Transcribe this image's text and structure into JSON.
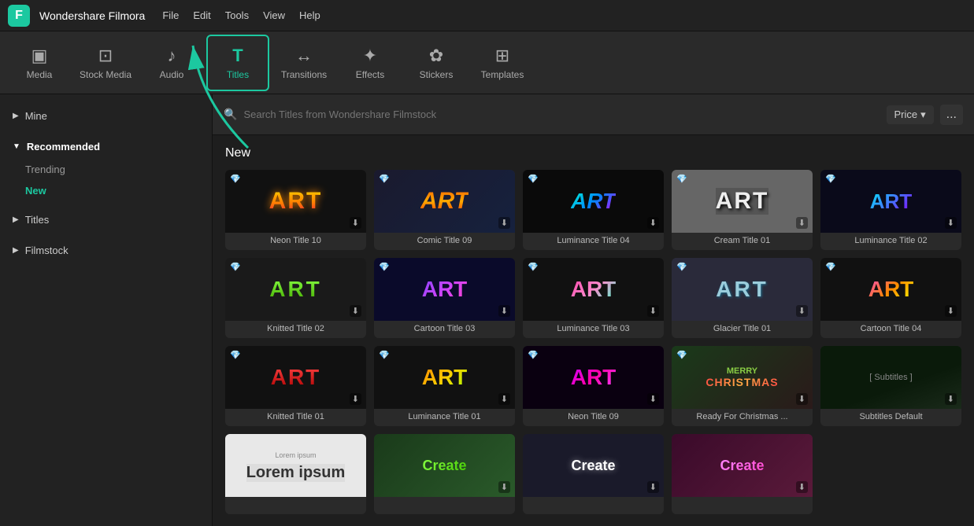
{
  "app": {
    "name": "Wondershare Filmora",
    "logo": "F"
  },
  "menu": {
    "items": [
      "File",
      "Edit",
      "Tools",
      "View",
      "Help"
    ]
  },
  "toolbar": {
    "items": [
      {
        "id": "media",
        "label": "Media",
        "icon": "▣"
      },
      {
        "id": "stock-media",
        "label": "Stock Media",
        "icon": "⊡"
      },
      {
        "id": "audio",
        "label": "Audio",
        "icon": "♪"
      },
      {
        "id": "titles",
        "label": "Titles",
        "icon": "T",
        "active": true
      },
      {
        "id": "transitions",
        "label": "Transitions",
        "icon": "↔"
      },
      {
        "id": "effects",
        "label": "Effects",
        "icon": "✦"
      },
      {
        "id": "stickers",
        "label": "Stickers",
        "icon": "✿"
      },
      {
        "id": "templates",
        "label": "Templates",
        "icon": "⊞"
      }
    ]
  },
  "sidebar": {
    "sections": [
      {
        "id": "mine",
        "label": "Mine",
        "expanded": false,
        "children": []
      },
      {
        "id": "recommended",
        "label": "Recommended",
        "expanded": true,
        "children": [
          {
            "id": "trending",
            "label": "Trending",
            "active": false
          },
          {
            "id": "new",
            "label": "New",
            "active": true
          }
        ]
      },
      {
        "id": "titles",
        "label": "Titles",
        "expanded": false,
        "children": []
      },
      {
        "id": "filmstock",
        "label": "Filmstock",
        "expanded": false,
        "children": []
      }
    ]
  },
  "search": {
    "placeholder": "Search Titles from Wondershare Filmstock",
    "price_label": "Price",
    "more_label": "..."
  },
  "content": {
    "section_label": "New",
    "titles": [
      {
        "id": "neon10",
        "label": "Neon Title 10",
        "text": "ART",
        "thumb_class": "thumb-neon10",
        "text_class": "t-neon10"
      },
      {
        "id": "comic09",
        "label": "Comic Title 09",
        "text": "ART",
        "thumb_class": "thumb-comic09",
        "text_class": "t-comic09"
      },
      {
        "id": "luminance04",
        "label": "Luminance Title 04",
        "text": "ART",
        "thumb_class": "thumb-luminance04",
        "text_class": "t-luminance04"
      },
      {
        "id": "cream01",
        "label": "Cream Title 01",
        "text": "ART",
        "thumb_class": "thumb-cream01",
        "text_class": "t-cream01"
      },
      {
        "id": "luminance02",
        "label": "Luminance Title 02",
        "text": "ART",
        "thumb_class": "thumb-luminance02",
        "text_class": "t-luminance02"
      },
      {
        "id": "knitted02",
        "label": "Knitted Title 02",
        "text": "ART",
        "thumb_class": "thumb-knitted02",
        "text_class": "t-knitted02"
      },
      {
        "id": "cartoon03",
        "label": "Cartoon Title 03",
        "text": "ART",
        "thumb_class": "thumb-cartoon03",
        "text_class": "t-cartoon03"
      },
      {
        "id": "luminance03",
        "label": "Luminance Title 03",
        "text": "ART",
        "thumb_class": "thumb-luminance03",
        "text_class": "t-luminance03"
      },
      {
        "id": "glacier01",
        "label": "Glacier Title 01",
        "text": "ART",
        "thumb_class": "thumb-glacier01",
        "text_class": "t-glacier01"
      },
      {
        "id": "cartoon04",
        "label": "Cartoon Title 04",
        "text": "ART",
        "thumb_class": "thumb-cartoon04",
        "text_class": "t-cartoon04"
      },
      {
        "id": "knitted01",
        "label": "Knitted Title 01",
        "text": "ART",
        "thumb_class": "thumb-knitted01",
        "text_class": "t-knitted01"
      },
      {
        "id": "luminance01",
        "label": "Luminance Title 01",
        "text": "ART",
        "thumb_class": "thumb-luminance01",
        "text_class": "t-luminance01"
      },
      {
        "id": "neon09",
        "label": "Neon Title 09",
        "text": "ART",
        "thumb_class": "thumb-neon09",
        "text_class": "t-neon09"
      },
      {
        "id": "christmas",
        "label": "Ready For Christmas ...",
        "text": "",
        "thumb_class": "thumb-christmas",
        "text_class": ""
      },
      {
        "id": "subtitles",
        "label": "Subtitles Default",
        "text": "",
        "thumb_class": "thumb-subtitles",
        "text_class": ""
      },
      {
        "id": "lorem",
        "label": "Lorem ipsum",
        "text": "Lorem ipsum",
        "thumb_class": "thumb-lorem",
        "text_class": "t-lorem"
      },
      {
        "id": "create-green",
        "label": "",
        "text": "Create",
        "thumb_class": "thumb-create-green",
        "text_class": "create-text"
      },
      {
        "id": "create-dark",
        "label": "",
        "text": "Create",
        "thumb_class": "thumb-create-dark",
        "text_class": "create-text-white"
      },
      {
        "id": "create-pink",
        "label": "",
        "text": "Create",
        "thumb_class": "thumb-create-pink",
        "text_class": "create-text-pink"
      }
    ]
  }
}
